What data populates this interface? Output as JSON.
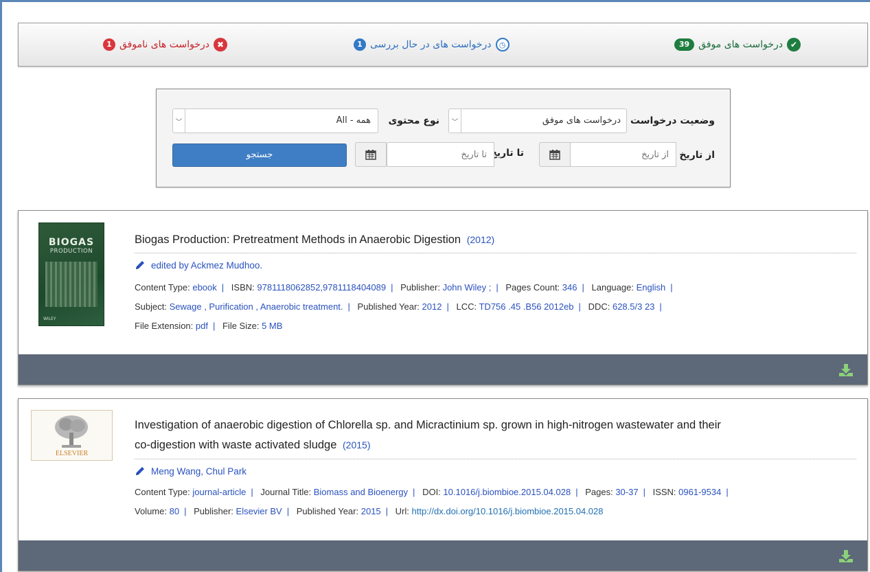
{
  "status_tabs": {
    "success": {
      "label": "درخواست های موفق",
      "count": "39"
    },
    "pending": {
      "label": "درخواست های در حال بررسی",
      "count": "1"
    },
    "failed": {
      "label": "درخواست های ناموفق",
      "count": "1"
    }
  },
  "filters": {
    "request_status_label": "وضعیت درخواست",
    "request_status_value": "درخواست های موفق",
    "content_type_label": "نوع محتوی",
    "content_type_value": "All - همه",
    "from_date_label": "از تاریخ",
    "from_date_placeholder": "از تاریخ",
    "to_date_label": "تا تاریخ",
    "to_date_placeholder": "تا تاریخ",
    "search_button": "جستجو"
  },
  "results": [
    {
      "title": "Biogas Production: Pretreatment Methods in Anaerobic Digestion",
      "year": "(2012)",
      "authors": "edited by Ackmez Mudhoo.",
      "cover_text": {
        "top": "BIOGAS",
        "sub": "PRODUCTION",
        "publisher": "WILEY"
      },
      "meta_rows": [
        [
          {
            "k": "Content Type:",
            "v": "ebook"
          },
          {
            "k": "ISBN:",
            "v": "9781118062852,9781118404089"
          },
          {
            "k": "Publisher:",
            "v": "John Wiley ;"
          },
          {
            "k": "Pages Count:",
            "v": "346"
          },
          {
            "k": "Language:",
            "v": "English"
          }
        ],
        [
          {
            "k": "Subject:",
            "v": "Sewage , Purification , Anaerobic treatment."
          },
          {
            "k": "Published Year:",
            "v": "2012"
          },
          {
            "k": "LCC:",
            "v": "TD756 .45 .B56 2012eb"
          },
          {
            "k": "DDC:",
            "v": "628.5/3 23"
          }
        ],
        [
          {
            "k": "File Extension:",
            "v": "pdf"
          },
          {
            "k": "File Size:",
            "v": "5 MB"
          }
        ]
      ]
    },
    {
      "title_line1": "Investigation of anaerobic digestion of Chlorella sp. and Micractinium sp. grown in high-nitrogen wastewater and their",
      "title_line2": "co-digestion with waste activated sludge",
      "year": "(2015)",
      "authors": "Meng Wang, Chul Park",
      "cover_text": {
        "publisher": "ELSEVIER"
      },
      "meta_rows": [
        [
          {
            "k": "Content Type:",
            "v": "journal-article"
          },
          {
            "k": "Journal Title:",
            "v": "Biomass and Bioenergy"
          },
          {
            "k": "DOI:",
            "v": "10.1016/j.biombioe.2015.04.028"
          },
          {
            "k": "Pages:",
            "v": "30-37"
          },
          {
            "k": "ISSN:",
            "v": "0961-9534"
          }
        ],
        [
          {
            "k": "Volume:",
            "v": "80"
          },
          {
            "k": "Publisher:",
            "v": "Elsevier BV"
          },
          {
            "k": "Published Year:",
            "v": "2015"
          },
          {
            "k": "Url:",
            "v": "http://dx.doi.org/10.1016/j.biombioe.2015.04.028"
          }
        ]
      ]
    }
  ],
  "colors": {
    "success": "#1e7d3f",
    "pending": "#3279c7",
    "failed": "#d9363e",
    "link": "#2a52be",
    "footer": "#5d6878",
    "search_button": "#3f7ec5"
  }
}
